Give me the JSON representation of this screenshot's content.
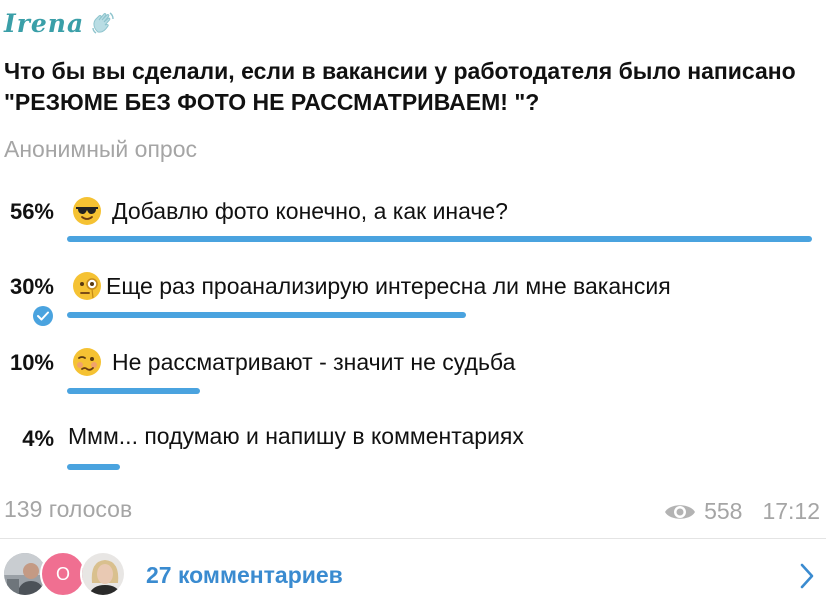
{
  "post": {
    "author": "Irena",
    "question": "Что бы вы сделали, если в вакансии у работодателя было написано \"РЕЗЮМЕ БЕЗ ФОТО НЕ РАССМАТРИВАЕМ! \"?",
    "poll_type": "Анонимный опрос"
  },
  "options": [
    {
      "percent": "56%",
      "text": "Добавлю фото конечно, а как иначе?",
      "fraction": 0.56,
      "emoji": "sunglasses-face-icon",
      "selected": false
    },
    {
      "percent": "30%",
      "text": "Еще раз проанализирую интересна ли мне вакансия",
      "fraction": 0.3,
      "emoji": "monocle-face-icon",
      "selected": true
    },
    {
      "percent": "10%",
      "text": "Не рассматривают - значит не судьба",
      "fraction": 0.1,
      "emoji": "woozy-face-icon",
      "selected": false
    },
    {
      "percent": "4%",
      "text": "Ммм... подумаю и напишу в комментариях",
      "fraction": 0.04,
      "emoji": "",
      "selected": false
    }
  ],
  "footer": {
    "votes": "139 голосов",
    "views": "558",
    "time": "17:12"
  },
  "comments": {
    "avatar_letter": "О",
    "label": "27 комментариев"
  },
  "colors": {
    "accent": "#4aa3df",
    "link": "#3a8bd0",
    "muted": "#a5a5a5",
    "author": "#3a9fa8",
    "avatar_pink": "#f06f91"
  }
}
